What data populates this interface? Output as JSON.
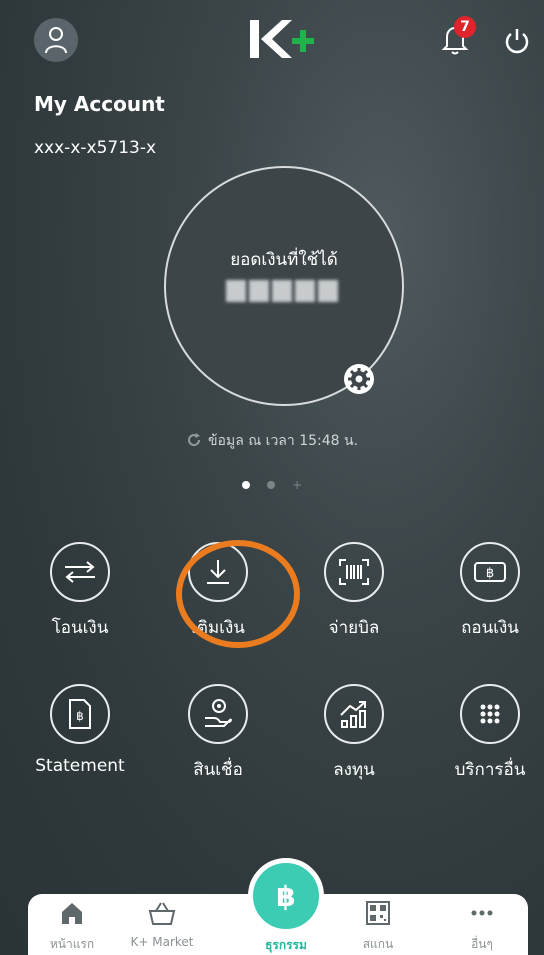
{
  "header": {
    "logo_text": "K+",
    "notification_count": "7"
  },
  "account": {
    "title": "My Account",
    "number": "xxx-x-x5713-x"
  },
  "balance": {
    "label": "ยอดเงินที่ใช้ได้"
  },
  "updated_text": "ข้อมูล ณ เวลา 15:48 น.",
  "actions": [
    {
      "label": "โอนเงิน",
      "icon": "transfer-icon"
    },
    {
      "label": "เติมเงิน",
      "icon": "download-icon"
    },
    {
      "label": "จ่ายบิล",
      "icon": "barcode-icon"
    },
    {
      "label": "ถอนเงิน",
      "icon": "baht-withdraw-icon"
    },
    {
      "label": "Statement",
      "icon": "statement-icon"
    },
    {
      "label": "สินเชื่อ",
      "icon": "loan-icon"
    },
    {
      "label": "ลงทุน",
      "icon": "invest-icon"
    },
    {
      "label": "บริการอื่น",
      "icon": "more-services-icon"
    }
  ],
  "bottom_nav": [
    {
      "label": "หน้าแรก",
      "icon": "home-icon"
    },
    {
      "label": "K+ Market",
      "icon": "basket-icon"
    },
    {
      "label": "ธุรกรรม",
      "icon": "baht-icon"
    },
    {
      "label": "สแกน",
      "icon": "qr-icon"
    },
    {
      "label": "อื่นๆ",
      "icon": "more-icon"
    }
  ],
  "colors": {
    "accent_green": "#3ccbb3",
    "badge_red": "#e0242b",
    "highlight_orange": "#ea7c1f"
  }
}
